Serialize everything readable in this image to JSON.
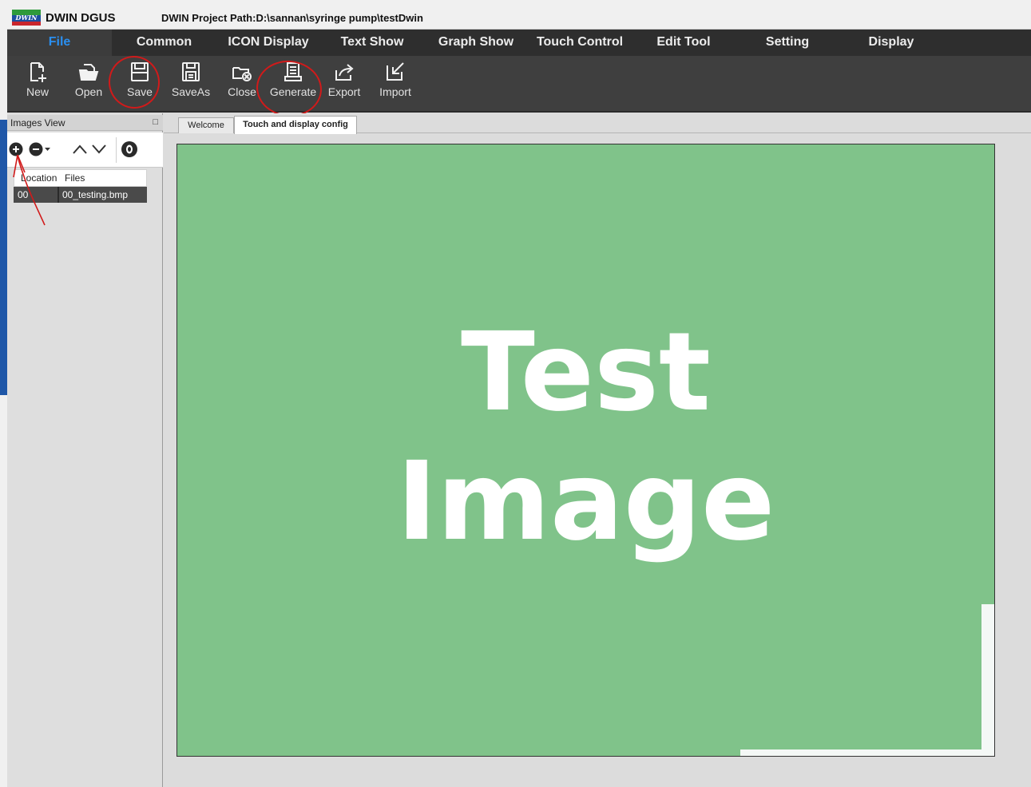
{
  "app": {
    "name": "DWIN DGUS",
    "logo_text": "DWIN",
    "project_path": "DWIN Project Path:D:\\sannan\\syringe pump\\testDwin"
  },
  "menu": [
    {
      "label": "File",
      "active": true
    },
    {
      "label": "Common"
    },
    {
      "label": "ICON Display"
    },
    {
      "label": "Text Show"
    },
    {
      "label": "Graph Show"
    },
    {
      "label": "Touch Control"
    },
    {
      "label": "Edit Tool"
    },
    {
      "label": "Setting"
    },
    {
      "label": "Display"
    }
  ],
  "ribbon": [
    {
      "label": "New",
      "icon": "new-file-icon"
    },
    {
      "label": "Open",
      "icon": "open-folder-icon"
    },
    {
      "label": "Save",
      "icon": "save-icon",
      "annotated": true
    },
    {
      "label": "SaveAs",
      "icon": "save-as-icon"
    },
    {
      "label": "Close",
      "icon": "close-project-icon"
    },
    {
      "label": "Generate",
      "icon": "generate-icon",
      "annotated": true
    },
    {
      "label": "Export",
      "icon": "export-icon"
    },
    {
      "label": "Import",
      "icon": "import-icon"
    }
  ],
  "images_view": {
    "title": "Images View",
    "pin_icon": "pin-icon",
    "tools": [
      "add-image-icon",
      "remove-image-icon",
      "move-up-icon",
      "move-down-icon",
      "preview-eye-icon"
    ],
    "columns": [
      "Location",
      "Files"
    ],
    "rows": [
      {
        "location": "00",
        "file": "00_testing.bmp",
        "selected": true
      }
    ]
  },
  "tabs": [
    {
      "label": "Welcome"
    },
    {
      "label": "Touch and display config",
      "active": true
    }
  ],
  "canvas": {
    "line1": "Test",
    "line2": "Image",
    "background": "#80c38a",
    "text_color": "#ffffff"
  },
  "colors": {
    "menubar": "#2e2e2e",
    "ribbon": "#3f3f3f",
    "active_menu": "#2a8ff0",
    "annotation": "#d11a1a"
  }
}
